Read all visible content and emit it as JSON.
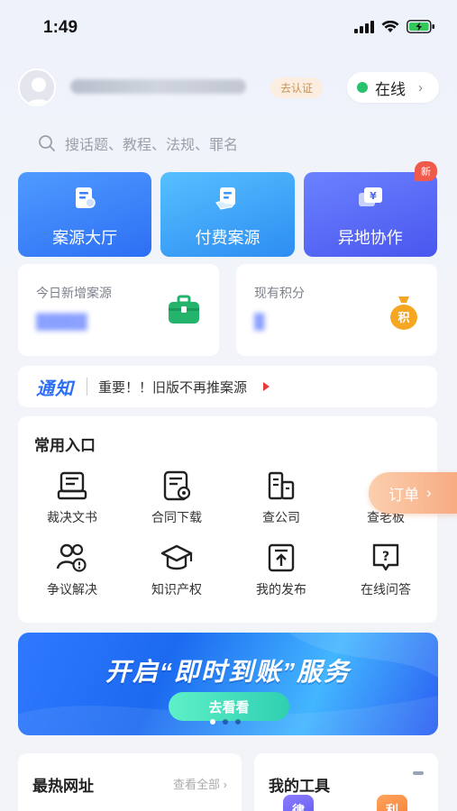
{
  "status_bar": {
    "time": "1:49"
  },
  "profile": {
    "verify_label": "去认证",
    "online_label": "在线"
  },
  "search": {
    "placeholder": "搜话题、教程、法规、罪名"
  },
  "tiles": [
    {
      "label": "案源大厅",
      "icon": "document-user-icon"
    },
    {
      "label": "付费案源",
      "icon": "document-hand-icon"
    },
    {
      "label": "异地协作",
      "icon": "yen-card-icon",
      "badge": "新"
    }
  ],
  "stats": [
    {
      "label": "今日新增案源",
      "icon": "briefcase-icon"
    },
    {
      "label": "现有积分",
      "icon": "points-bag-icon",
      "icon_text": "积"
    }
  ],
  "notice": {
    "logo": "通知",
    "text": "重要！！旧版不再推案源"
  },
  "entries": {
    "title": "常用入口",
    "items": [
      {
        "label": "裁决文书",
        "icon": "ruling-document-icon"
      },
      {
        "label": "合同下载",
        "icon": "contract-download-icon"
      },
      {
        "label": "查公司",
        "icon": "company-building-icon"
      },
      {
        "label": "查老板",
        "icon": "boss-search-icon"
      },
      {
        "label": "争议解决",
        "icon": "dispute-people-icon"
      },
      {
        "label": "知识产权",
        "icon": "graduation-cap-icon"
      },
      {
        "label": "我的发布",
        "icon": "upload-box-icon"
      },
      {
        "label": "在线问答",
        "icon": "question-bubble-icon"
      }
    ]
  },
  "order_float": {
    "label": "订单"
  },
  "banner": {
    "title": "开启“即时到账”服务",
    "button": "去看看"
  },
  "hot_sites": {
    "title": "最热网址",
    "more": "查看全部"
  },
  "my_tools": {
    "title": "我的工具",
    "chips": [
      "律",
      "利"
    ]
  }
}
